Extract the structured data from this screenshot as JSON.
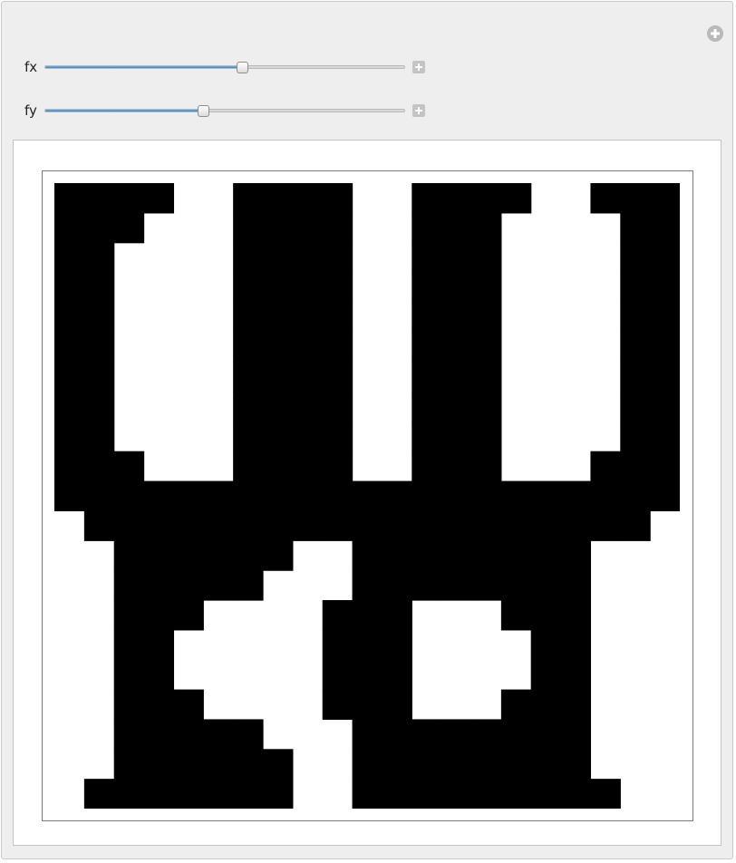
{
  "controls": {
    "fx": {
      "label": "fx",
      "value_fraction": 0.55
    },
    "fy": {
      "label": "fy",
      "value_fraction": 0.44
    }
  },
  "colors": {
    "slider_fill": "#3a8ad2",
    "cell_on": "#000000",
    "cell_off": "#ffffff"
  },
  "icons": {
    "add": "plus-circle-icon",
    "increment": "plus-box-icon"
  },
  "pattern": {
    "rows": 21,
    "cols": 21,
    "bitmap": [
      "111100111100111100111",
      "111000111100111000011",
      "110000111100111000011",
      "110000111100111000011",
      "110000111100111000011",
      "110000111100111000011",
      "110000111100111000011",
      "110000111100111000011",
      "110000111100111000011",
      "111000111100111000111",
      "111111111111111111111",
      "011111111111111111110",
      "001111110011111111000",
      "001111100011111111000",
      "001110000111000111000",
      "001100000111000011000",
      "001100000111000011000",
      "001110000111000111000",
      "001111100011111111000",
      "001111110011111111000",
      "011111110011111111100"
    ]
  }
}
